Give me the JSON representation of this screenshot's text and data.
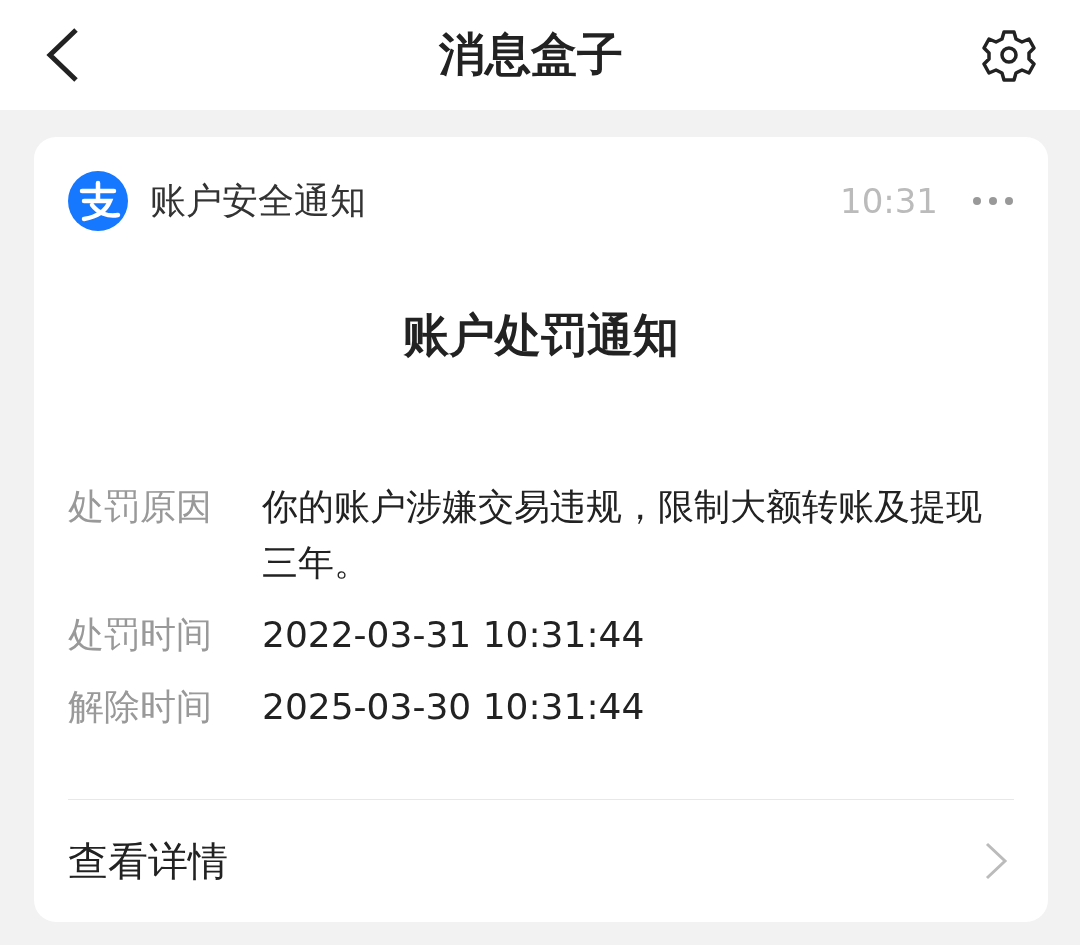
{
  "header": {
    "title": "消息盒子"
  },
  "card": {
    "source": "账户安全通知",
    "time": "10:31",
    "headline": "账户处罚通知",
    "details": [
      {
        "label": "处罚原因",
        "value": "你的账户涉嫌交易违规，限制大额转账及提现三年。"
      },
      {
        "label": "处罚时间",
        "value": "2022-03-31 10:31:44"
      },
      {
        "label": "解除时间",
        "value": "2025-03-30 10:31:44"
      }
    ],
    "link": "查看详情"
  }
}
